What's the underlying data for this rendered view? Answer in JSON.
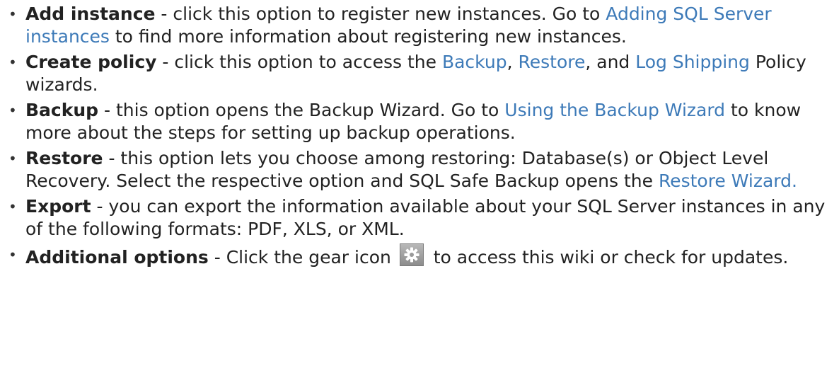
{
  "items": [
    {
      "title": "Add instance",
      "text1": " - click this option to register new instances. Go to ",
      "link1": "Adding SQL Server instances",
      "text2": " to find more information about registering new instances."
    },
    {
      "title": "Create policy",
      "text1": " - click this option to access the ",
      "link1": "Backup",
      "text2": ", ",
      "link2": "Restore",
      "text3": ", and ",
      "link3": "Log Shipping",
      "text4": " Policy wizards."
    },
    {
      "title": "Backup",
      "text1": " - this option opens the Backup Wizard. Go to ",
      "link1": "Using the Backup Wizard",
      "text2": " to know more about the steps for setting up backup operations."
    },
    {
      "title": "Restore",
      "text1": " - this option lets you choose among restoring: Database(s) or Object Level Recovery. Select the respective option and SQL Safe Backup opens the ",
      "link1": "Restore Wizard."
    },
    {
      "title": "Export",
      "text1": " - you can export the information available about your SQL Server instances in any of the following formats: PDF, XLS, or XML."
    },
    {
      "title": "Additional options",
      "text1": " - Click the gear icon ",
      "icon": "gear-icon",
      "text2": " to access this wiki or check for updates."
    }
  ],
  "colors": {
    "link": "#3d7ab8",
    "text": "#222222"
  }
}
